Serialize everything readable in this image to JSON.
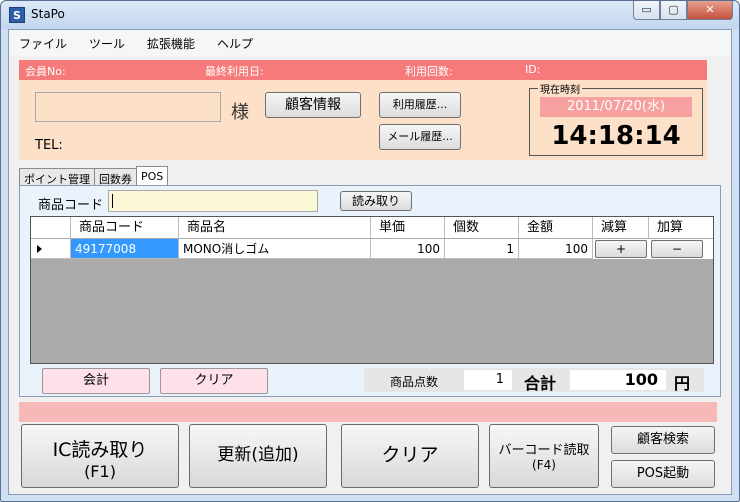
{
  "window": {
    "title": "StaPo",
    "icon": "S"
  },
  "window_controls": {
    "minimize": "▭",
    "maximize": "▢",
    "close": "✕"
  },
  "menu": [
    "ファイル",
    "ツール",
    "拡張機能",
    "ヘルプ"
  ],
  "customer": {
    "member_no_label": "会員No:",
    "last_used_label": "最終利用日:",
    "usage_count_label": "利用回数:",
    "id_label": "ID:",
    "name_value": "",
    "honorific": "様",
    "tel_label": "TEL:",
    "info_button": "顧客情報",
    "usage_history_button": "利用履歴...",
    "mail_history_button": "メール履歴...",
    "clock_label": "現在時刻",
    "date": "2011/07/20(水)",
    "time": "14:18:14"
  },
  "tabs": [
    "ポイント管理",
    "回数券",
    "POS"
  ],
  "pos": {
    "code_label": "商品コード",
    "code_value": "",
    "read_button": "読み取り",
    "columns": [
      "商品コード",
      "商品名",
      "単価",
      "個数",
      "金額",
      "減算",
      "加算"
    ],
    "rows": [
      {
        "code": "49177008",
        "name": "MONO消しゴム",
        "price": "100",
        "qty": "1",
        "amount": "100",
        "sub": "+",
        "add": "−"
      }
    ],
    "checkout_button": "会計",
    "clear_button": "クリア",
    "item_count_label": "商品点数",
    "item_count": "1",
    "total_label": "合計",
    "total": "100",
    "yen": "円"
  },
  "actions": {
    "ic_read_line1": "IC読み取り",
    "ic_read_line2": "(F1)",
    "update": "更新(追加)",
    "clear": "クリア",
    "barcode_line1": "バーコード読取",
    "barcode_line2": "(F4)",
    "customer_search": "顧客検索",
    "pos_start": "POS起動"
  }
}
